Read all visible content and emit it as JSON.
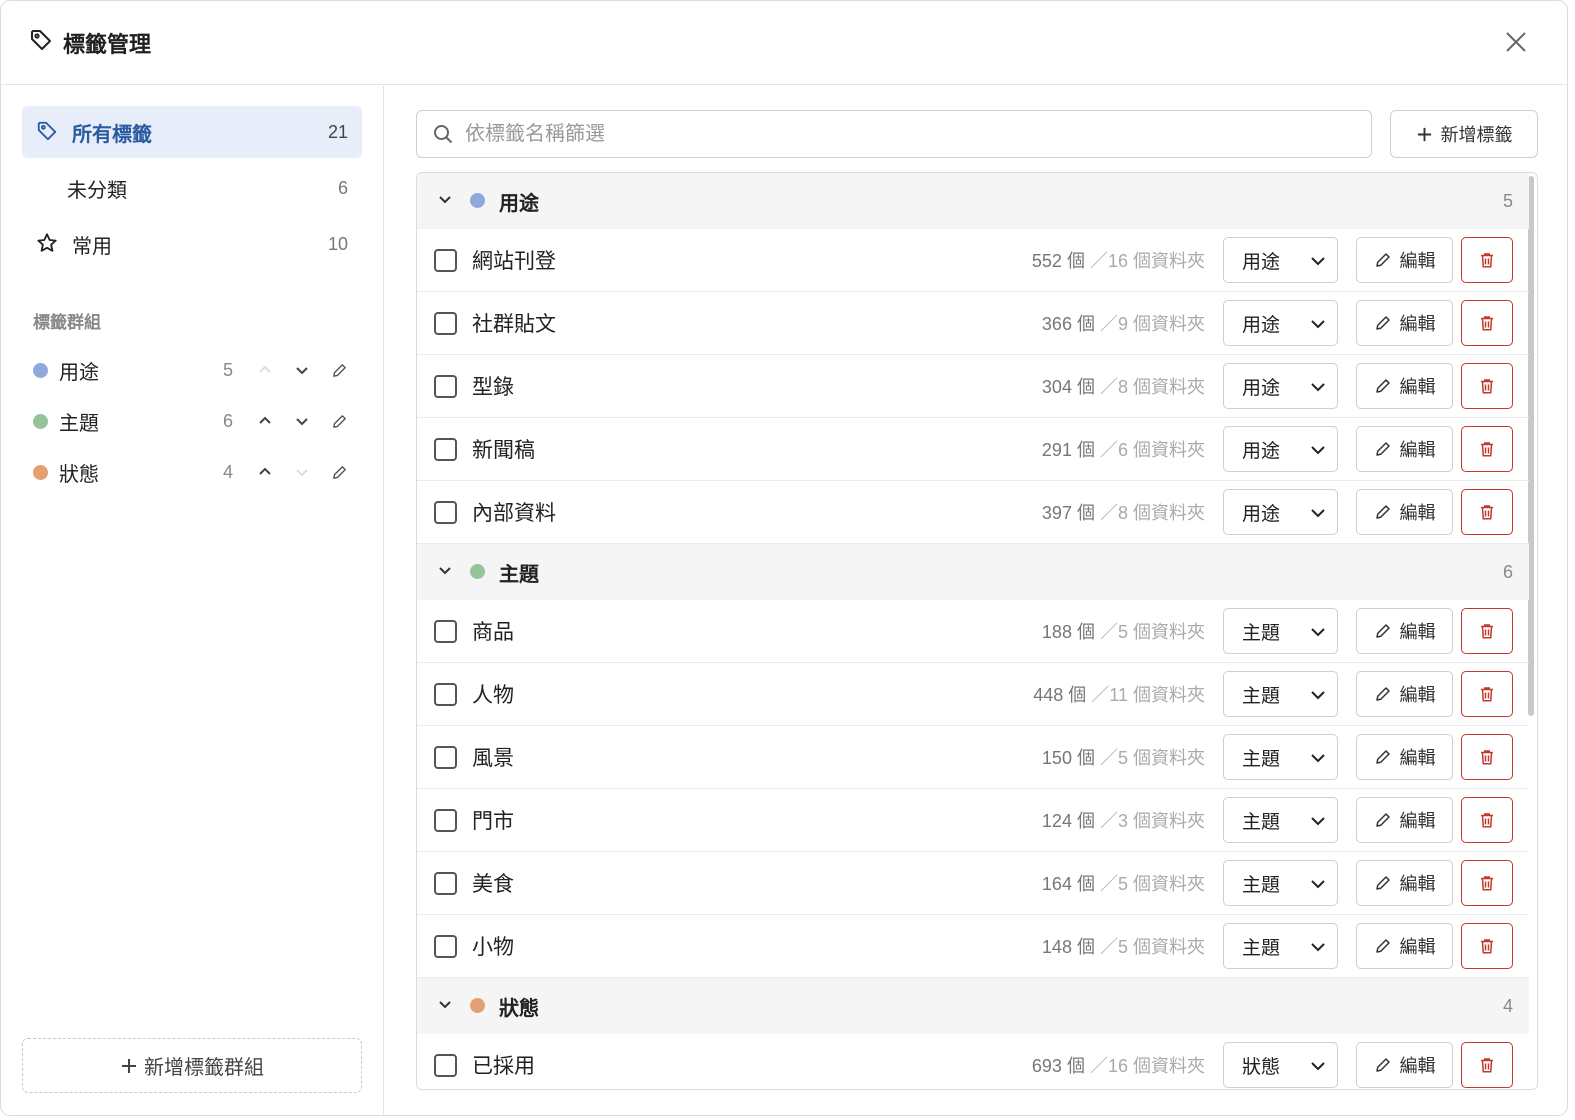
{
  "dialog": {
    "title": "標籤管理"
  },
  "sidebar": {
    "nav": [
      {
        "label": "所有標籤",
        "count": "21",
        "active": true,
        "icon": "tag-icon"
      },
      {
        "label": "未分類",
        "count": "6",
        "active": false,
        "icon": ""
      },
      {
        "label": "常用",
        "count": "10",
        "active": false,
        "icon": "star-icon"
      }
    ],
    "section_title": "標籤群組",
    "groups": [
      {
        "name": "用途",
        "count": "5",
        "color": "#8fa9dc"
      },
      {
        "name": "主題",
        "count": "6",
        "color": "#96c49a"
      },
      {
        "name": "狀態",
        "count": "4",
        "color": "#e3a073"
      }
    ],
    "add_group_label": "新增標籤群組"
  },
  "main": {
    "search_placeholder": "依標籤名稱篩選",
    "add_tag_label": "新增標籤",
    "edit_label": "編輯",
    "groups": [
      {
        "name": "用途",
        "count": "5",
        "color": "#8fa9dc",
        "tags": [
          {
            "name": "網站刊登",
            "items": "552 個",
            "folders": "／16 個資料夾",
            "group": "用途"
          },
          {
            "name": "社群貼文",
            "items": "366 個",
            "folders": "／9 個資料夾",
            "group": "用途"
          },
          {
            "name": "型錄",
            "items": "304 個",
            "folders": "／8 個資料夾",
            "group": "用途"
          },
          {
            "name": "新聞稿",
            "items": "291 個",
            "folders": "／6 個資料夾",
            "group": "用途"
          },
          {
            "name": "內部資料",
            "items": "397 個",
            "folders": "／8 個資料夾",
            "group": "用途"
          }
        ]
      },
      {
        "name": "主題",
        "count": "6",
        "color": "#96c49a",
        "tags": [
          {
            "name": "商品",
            "items": "188 個",
            "folders": "／5 個資料夾",
            "group": "主題"
          },
          {
            "name": "人物",
            "items": "448 個",
            "folders": "／11 個資料夾",
            "group": "主題"
          },
          {
            "name": "風景",
            "items": "150 個",
            "folders": "／5 個資料夾",
            "group": "主題"
          },
          {
            "name": "門市",
            "items": "124 個",
            "folders": "／3 個資料夾",
            "group": "主題"
          },
          {
            "name": "美食",
            "items": "164 個",
            "folders": "／5 個資料夾",
            "group": "主題"
          },
          {
            "name": "小物",
            "items": "148 個",
            "folders": "／5 個資料夾",
            "group": "主題"
          }
        ]
      },
      {
        "name": "狀態",
        "count": "4",
        "color": "#e3a073",
        "tags": [
          {
            "name": "已採用",
            "items": "693 個",
            "folders": "／16 個資料夾",
            "group": "狀態"
          }
        ]
      }
    ]
  }
}
